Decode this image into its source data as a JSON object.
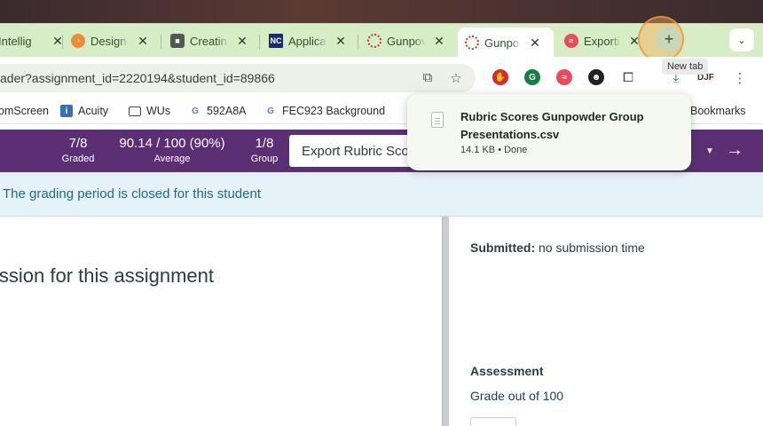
{
  "browser": {
    "tabs": [
      {
        "label": "Intellig",
        "icon": "intellig-tab-icon",
        "color": "#8a7f6a"
      },
      {
        "label": "Design",
        "icon": "design-tab-icon",
        "color": "#f28b30"
      },
      {
        "label": "Creatin",
        "icon": "cube-tab-icon",
        "color": "#444444"
      },
      {
        "label": "Applica",
        "icon": "nc-tab-icon",
        "color": "#1a2a6c"
      },
      {
        "label": "Gunpov",
        "icon": "canvas-tab-icon",
        "color": "#c0392b"
      },
      {
        "label": "Gunpo",
        "icon": "canvas-tab-icon",
        "color": "#c0392b",
        "active": true
      },
      {
        "label": "Exporti",
        "icon": "export-tab-icon",
        "color": "#e74c5c"
      }
    ],
    "close_glyph": "✕",
    "new_tab_glyph": "+",
    "new_tab_tooltip": "New tab",
    "tab_list_glyph": "⌄",
    "address": "ader?assignment_id=2220194&student_id=89866",
    "profile_initials": "DJF",
    "bookmarks": [
      {
        "label": "omScreen",
        "icon": ""
      },
      {
        "label": "Acuity",
        "icon": "acuity-icon"
      },
      {
        "label": "WUs",
        "icon": "folder-icon"
      },
      {
        "label": "592A8A",
        "icon": "google-icon"
      },
      {
        "label": "FEC923 Background",
        "icon": "google-icon"
      },
      {
        "label": "Bookmarks",
        "icon": ""
      }
    ]
  },
  "download": {
    "file_name": "Rubric Scores Gunpowder Group Presentations.csv",
    "meta": "14.1 KB • Done"
  },
  "speedgrader": {
    "graded_value": "7/8",
    "graded_label": "Graded",
    "average_value": "90.14 / 100 (90%)",
    "average_label": "Average",
    "group_value": "1/8",
    "group_label": "Group",
    "export_label": "Export Rubric Sco",
    "banner": "The grading period is closed for this student",
    "submission_message": "ission for this assignment",
    "submitted_label": "Submitted:",
    "submitted_value": " no submission time",
    "assessment_heading": "Assessment",
    "grade_out_of": "Grade out of 100"
  },
  "colors": {
    "tabstrip": "#d7edc6",
    "canvas_purple": "#5c2f74",
    "banner_bg": "#e5f2f8",
    "banner_text": "#1f6a86"
  }
}
